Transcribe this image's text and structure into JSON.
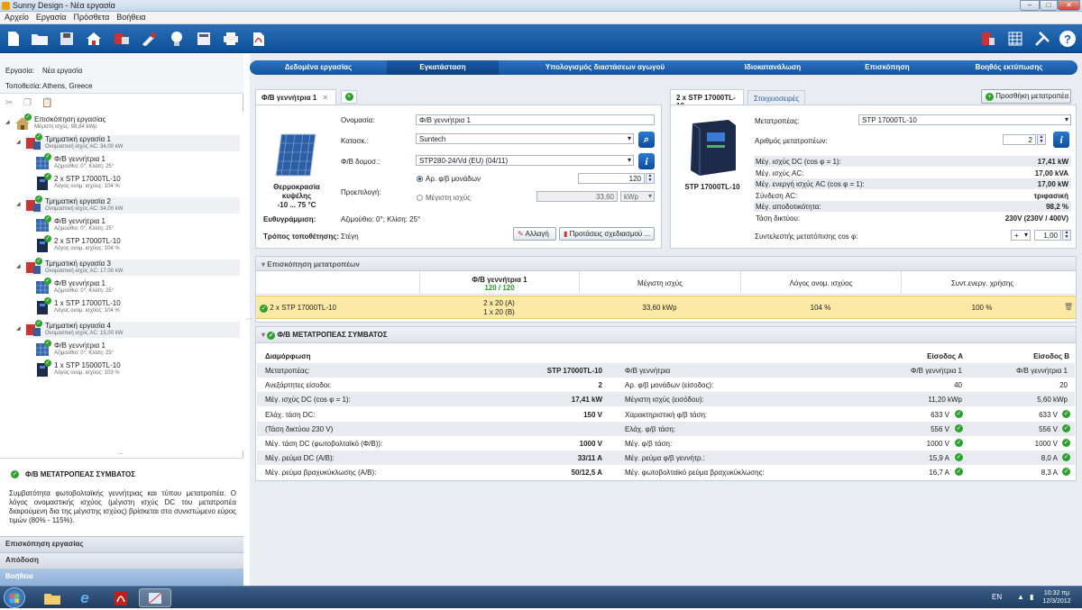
{
  "window": {
    "title": "Sunny Design - Νέα εργασία",
    "min": "–",
    "max": "□",
    "close": "✕"
  },
  "menu": [
    "Αρχείο",
    "Εργασία",
    "Πρόσθετα",
    "Βοήθεια"
  ],
  "left": {
    "project_label": "Εργασία:",
    "project_value": "Νέα εργασία",
    "location_label": "Τοποθεσία:",
    "location_value": "Athens, Greece",
    "tree": [
      {
        "title": "Επισκόπηση εργασίας",
        "sub": "Μέγιστη ισχύς: 98,84 kWp"
      },
      {
        "title": "Τμηματική εργασία 1",
        "sub": "Ονομαστική ισχύς AC: 34,00 kW"
      },
      {
        "title": "Φ/Β γεννήτρια 1",
        "sub": "Αζιμούθιο: 0°; Κλίση: 25°"
      },
      {
        "title": "2 x STP 17000TL-10",
        "sub": "Λόγος ονομ. ισχύος: 104 %"
      },
      {
        "title": "Τμηματική εργασία 2",
        "sub": "Ονομαστική ισχύς AC: 34,00 kW"
      },
      {
        "title": "Φ/Β γεννήτρια 1",
        "sub": "Αζιμούθιο: 0°; Κλίση: 25°"
      },
      {
        "title": "2 x STP 17000TL-10",
        "sub": "Λόγος ονομ. ισχύος: 104 %"
      },
      {
        "title": "Τμηματική εργασία 3",
        "sub": "Ονομαστική ισχύς AC: 17,00 kW"
      },
      {
        "title": "Φ/Β γεννήτρια 1",
        "sub": "Αζιμούθιο: 0°; Κλίση: 25°"
      },
      {
        "title": "1 x STP 17000TL-10",
        "sub": "Λόγος ονομ. ισχύος: 104 %"
      },
      {
        "title": "Τμηματική εργασία 4",
        "sub": "Ονομαστική ισχύς AC: 15,00 kW"
      },
      {
        "title": "Φ/Β γεννήτρια 1",
        "sub": "Αζιμούθιο: 0°; Κλίση: 25°"
      },
      {
        "title": "1 x STP 15000TL-10",
        "sub": "Λόγος ονομ. ισχύος: 103 %"
      }
    ],
    "info_title": "Φ/Β ΜΕΤΑΤΡΟΠΕΑΣ ΣΥΜΒΑΤΟΣ",
    "info_text": "Συμβατότητα φωτοβολταϊκής γεννήτριας και τύπου μετατροπέα. Ο λόγος ονομαστικής ισχύος (μέγιστη ισχύς DC του μετατροπέα διαιρούμενη δια της μέγιστης ισχύος) βρίσκεται στο συνιστώμενο εύρος τιμών (80% - 115%).",
    "accordion": [
      "Επισκόπηση εργασίας",
      "Απόδοση",
      "Βοήθεια"
    ],
    "splitter": "..."
  },
  "steps": [
    "Δεδομένα εργασίας",
    "Εγκατάσταση",
    "Υπολογισμός διαστάσεων αγωγού",
    "Ιδιοκατανάλωση",
    "Επισκόπηση",
    "Βοηθός εκτύπωσης"
  ],
  "pv": {
    "tab": "Φ/Β γεννήτρια 1",
    "tab_close": "✕",
    "add": "+",
    "name_label": "Ονομασία:",
    "name_value": "Φ/Β γεννήτρια 1",
    "mfr_label": "Κατασκ.:",
    "mfr_value": "Suntech",
    "module_label": "Φ/Β δομοσ.:",
    "module_value": "STP280-24/Vd (EU) (04/11)",
    "preset_label": "Προεπιλογή:",
    "opt1": "Αρ. φ/β μονάδων",
    "opt1_value": "120",
    "opt2": "Μέγιστη ισχύς",
    "opt2_value": "33,60",
    "opt2_unit": "kWp",
    "temp_label": "Θερμοκρασία κυψέλης",
    "temp_value": "-10 ... 75 °C",
    "align_label": "Ευθυγράμμιση:",
    "align_value": "Αζιμούθιο: 0°; Κλίση: 25°",
    "mount_label": "Τρόπος τοποθέτησης:",
    "mount_value": "Στέγη",
    "change_btn": "Αλλαγή",
    "suggest_btn": "Προτάσεις σχεδιασμού ..."
  },
  "inv": {
    "tab1": "2 x STP 17000TL-10",
    "tab2": "Στοιχειοσειρές",
    "add_btn": "Προσθήκη μετατροπέα",
    "caption": "STP 17000TL-10",
    "inv_label": "Μετατροπέας:",
    "inv_value": "STP 17000TL-10",
    "count_label": "Αριθμός μετατροπέων:",
    "count_value": "2",
    "specs": [
      {
        "k": "Μέγ. ισχύς DC (cos φ = 1):",
        "v": "17,41 kW"
      },
      {
        "k": "Μέγ. ισχύς AC:",
        "v": "17,00 kVA"
      },
      {
        "k": "Μέγ. ενεργή ισχύς AC (cos φ = 1):",
        "v": "17,00 kW"
      },
      {
        "k": "Σύνδεση AC:",
        "v": "τριφασική"
      },
      {
        "k": "Μέγ. αποδοτικότητα:",
        "v": "98,2 %"
      },
      {
        "k": "Τάση δικτύου:",
        "v": "230V (230V / 400V)"
      }
    ],
    "cos_label": "Συντελεστής μετατόπισης cos φ:",
    "cos_sign": "+",
    "cos_value": "1,00"
  },
  "overview": {
    "title": "Επισκόπηση μετατροπέων",
    "col1": "Φ/Β γεννήτρια 1",
    "col1_sub": "120 / 120",
    "col2": "Μέγιστη ισχύς",
    "col3": "Λόγος ονομ. ισχύος",
    "col4": "Συντ.ενεργ. χρήσης",
    "row_name": "2 x STP 17000TL-10",
    "row_a": "2 x 20 (A)",
    "row_b": "1 x 20 (B)",
    "row_p": "33,60 kWp",
    "row_r": "104 %",
    "row_u": "100 %"
  },
  "compat": {
    "title": "Φ/Β ΜΕΤΑΤΡΟΠΕΑΣ ΣΥΜΒΑΤΟΣ",
    "config": "Διαμόρφωση",
    "inA": "Είσοδος A",
    "inB": "Είσοδος B",
    "left": [
      {
        "k": "Μετατροπέας:",
        "v": "STP 17000TL-10"
      },
      {
        "k": "Ανεξάρτητες είσοδοι:",
        "v": "2"
      },
      {
        "k": "Μέγ. ισχύς DC (cos φ = 1):",
        "v": "17,41 kW"
      },
      {
        "k": "Ελάχ. τάση DC:",
        "v": "150 V"
      },
      {
        "k": "(Τάση δικτύου 230 V)",
        "v": ""
      },
      {
        "k": "Μέγ. τάση DC (φωτοβολταϊκό (Φ/Β)):",
        "v": "1000 V"
      },
      {
        "k": "Μέγ. ρεύμα DC (A/B):",
        "v": "33/11 A"
      },
      {
        "k": "Μέγ. ρεύμα βραχυκύκλωσης (A/B):",
        "v": "50/12,5 A"
      }
    ],
    "right": [
      {
        "k": "Φ/Β γεννήτρια",
        "a": "Φ/Β γεννήτρια 1",
        "b": "Φ/Β γεννήτρια 1",
        "ok": false
      },
      {
        "k": "Αρ. φ/β μονάδων (είσοδος):",
        "a": "40",
        "b": "20",
        "ok": false
      },
      {
        "k": "Μέγιστη ισχύς (εισόδου):",
        "a": "11,20 kWp",
        "b": "5,60 kWp",
        "ok": false
      },
      {
        "k": "Χαρακτηριστική φ/β τάση:",
        "a": "633 V",
        "b": "633 V",
        "ok": true
      },
      {
        "k": "Ελάχ. φ/β τάση:",
        "a": "556 V",
        "b": "556 V",
        "ok": true
      },
      {
        "k": "Μέγ. φ/β τάση:",
        "a": "1000 V",
        "b": "1000 V",
        "ok": true
      },
      {
        "k": "Μέγ. ρεύμα φ/β γεννήτρ.:",
        "a": "15,9 A",
        "b": "8,0 A",
        "ok": true
      },
      {
        "k": "Μέγ. φωτοβολταϊκό ρεύμα βραχυκύκλωσης:",
        "a": "16,7 A",
        "b": "8,3 A",
        "ok": true
      }
    ]
  },
  "taskbar": {
    "lang": "EN",
    "time": "10:32 πμ",
    "date": "12/3/2012"
  }
}
